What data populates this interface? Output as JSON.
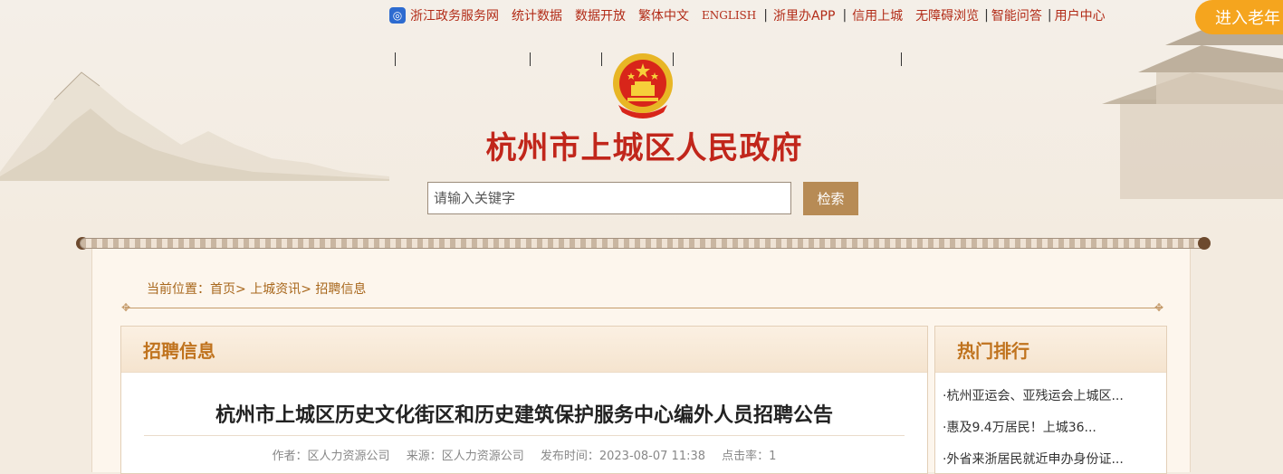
{
  "topbar": {
    "links": [
      "浙江政务服务网",
      "统计数据",
      "数据开放",
      "繁体中文",
      "ENGLISH",
      "浙里办APP",
      "信用上城",
      "无障碍浏览",
      "智能问答",
      "用户中心"
    ],
    "elder_button": "进入老年"
  },
  "site_title": "杭州市上城区人民政府",
  "search": {
    "placeholder": "请输入关键字",
    "button": "检索"
  },
  "breadcrumb": {
    "prefix": "当前位置：",
    "items": [
      "首页",
      "上城资讯",
      "招聘信息"
    ],
    "separator": ">"
  },
  "main": {
    "section_title": "招聘信息",
    "article_title": "杭州市上城区历史文化街区和历史建筑保护服务中心编外人员招聘公告",
    "meta": {
      "author": "作者：区人力资源公司",
      "source": "来源：区人力资源公司",
      "published": "发布时间：2023-08-07 11:38",
      "clicks": "点击率：1"
    }
  },
  "sidebar": {
    "title": "热门排行",
    "items": [
      "·杭州亚运会、亚残运会上城区...",
      "·惠及9.4万居民！上城36...",
      "·外省来浙居民就近申办身份证..."
    ]
  },
  "colors": {
    "brand_red": "#c1261b",
    "accent_brown": "#b78b55",
    "elder_orange": "#f5a51e",
    "section_orange": "#c0731e"
  }
}
